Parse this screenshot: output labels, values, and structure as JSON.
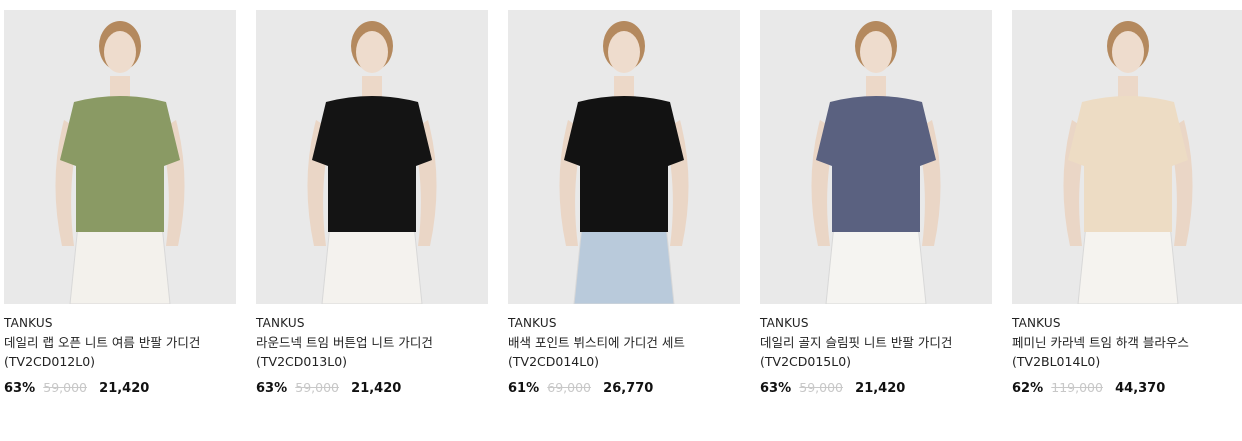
{
  "products": [
    {
      "brand": "TANKUS",
      "name": "데일리 랩 오픈 니트 여름 반팔 가디건 (TV2CD012L0)",
      "discount": "63%",
      "original_price": "59,000",
      "sale_price": "21,420",
      "image_icon": "product-photo-green-wrap-cardigan",
      "top_color": "#8a9a64",
      "bottom_color": "#f3f1ec"
    },
    {
      "brand": "TANKUS",
      "name": "라운드넥 트임 버튼업 니트 가디건 (TV2CD013L0)",
      "discount": "63%",
      "original_price": "59,000",
      "sale_price": "21,420",
      "image_icon": "product-photo-black-button-cardigan",
      "top_color": "#141414",
      "bottom_color": "#f4f2ee"
    },
    {
      "brand": "TANKUS",
      "name": "배색 포인트 뷔스티에 가디건 세트 (TV2CD014L0)",
      "discount": "61%",
      "original_price": "69,000",
      "sale_price": "26,770",
      "image_icon": "product-photo-black-bustier-cardigan-set",
      "top_color": "#121212",
      "bottom_color": "#b9cadb"
    },
    {
      "brand": "TANKUS",
      "name": "데일리 골지 슬림핏 니트 반팔 가디건 (TV2CD015L0)",
      "discount": "63%",
      "original_price": "59,000",
      "sale_price": "21,420",
      "image_icon": "product-photo-navy-ribbed-cardigan",
      "top_color": "#5a6180",
      "bottom_color": "#f5f4f1"
    },
    {
      "brand": "TANKUS",
      "name": "페미닌 카라넥 트임 하객 블라우스 (TV2BL014L0)",
      "discount": "62%",
      "original_price": "119,000",
      "sale_price": "44,370",
      "image_icon": "product-photo-beige-collar-blouse",
      "top_color": "#eddcc4",
      "bottom_color": "#f5f3ef"
    }
  ]
}
